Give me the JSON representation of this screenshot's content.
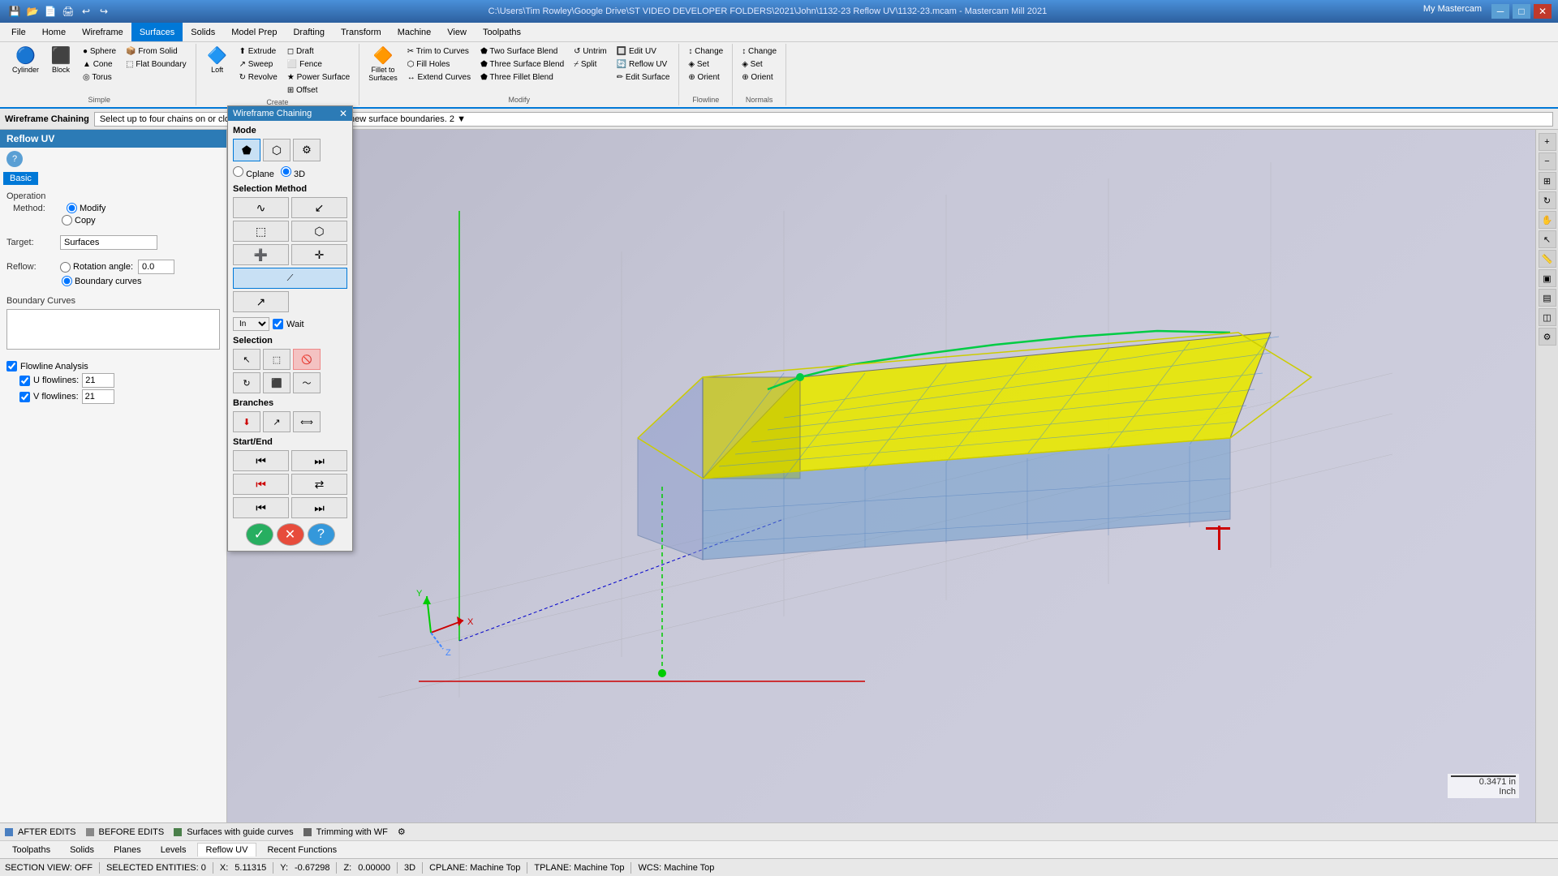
{
  "titlebar": {
    "title": "C:\\Users\\Tim Rowley\\Google Drive\\ST VIDEO DEVELOPER FOLDERS\\2021\\John\\1132-23 Reflow UV\\1132-23.mcam - Mastercam Mill 2021",
    "close": "✕",
    "maximize": "□",
    "minimize": "─",
    "my_mastercam": "My Mastercam"
  },
  "menubar": {
    "items": [
      "File",
      "Home",
      "Wireframe",
      "Surfaces",
      "Solids",
      "Model Prep",
      "Drafting",
      "Transform",
      "Machine",
      "View",
      "Toolpaths"
    ]
  },
  "ribbon": {
    "active_tab": "Surfaces",
    "groups": {
      "simple": {
        "title": "Simple",
        "items": [
          "Cylinder",
          "Block",
          "Sphere",
          "Cone",
          "Torus",
          "From Solid",
          "Flat Boundary"
        ]
      },
      "create": {
        "title": "Create",
        "items": [
          "Extrude",
          "Sweep",
          "Revolve",
          "Draft",
          "Fence",
          "Power Surface",
          "Offset",
          "Loft"
        ]
      },
      "modify": {
        "title": "Modify",
        "items": [
          "Trim to Curves",
          "Fill Holes",
          "Extend Curves",
          "Fillet to Surfaces",
          "Two Surface Blend",
          "Three Surface Blend",
          "Three Fillet Blend",
          "Untrim",
          "Split",
          "Edit UV",
          "Reflow UV",
          "Edit Surface"
        ]
      },
      "flowline": {
        "title": "Flowline",
        "items": [
          "Change",
          "Set",
          "Orient"
        ]
      },
      "normals": {
        "title": "Normals",
        "items": [
          "Change",
          "Set",
          "Orient"
        ]
      }
    }
  },
  "chaining": {
    "label": "Wireframe Chaining",
    "message": "Select up to four chains on or close to the surface to define the new surface boundaries.  2 ▼"
  },
  "left_panel": {
    "title": "Reflow UV",
    "tab": "Basic",
    "operation_label": "Operation",
    "method_label": "Method:",
    "method_options": [
      "Modify",
      "Copy"
    ],
    "method_selected": "Modify",
    "target_label": "Target:",
    "target_value": "Surfaces",
    "reflow_label": "Reflow:",
    "reflow_options": [
      "Rotation angle:",
      "Boundary curves"
    ],
    "reflow_selected": "Boundary curves",
    "rotation_angle": "0.0",
    "boundary_curves_label": "Boundary Curves",
    "flowline_label": "Flowline Analysis",
    "u_flowlines_checked": true,
    "u_flowlines_label": "U flowlines:",
    "u_flowlines_value": "21",
    "v_flowlines_checked": true,
    "v_flowlines_label": "V flowlines:",
    "v_flowlines_value": "21"
  },
  "wireframe_dialog": {
    "title": "Wireframe Chaining",
    "mode_label": "Mode",
    "mode_buttons": [
      "⬟",
      "⬡",
      "⚙"
    ],
    "plane_label1": "Cplane",
    "plane_label2": "3D",
    "selection_method_label": "Selection Method",
    "in_label": "In",
    "wait_label": "Wait",
    "selection_label": "Selection",
    "branches_label": "Branches",
    "startend_label": "Start/End",
    "ok_label": "✓",
    "cancel_label": "✕",
    "help_label": "?"
  },
  "status_bar": {
    "section_view": "SECTION VIEW: OFF",
    "selected_entities": "SELECTED ENTITIES: 0",
    "x_label": "X:",
    "x_value": "5.11315",
    "y_label": "Y:",
    "y_value": "-0.67298",
    "z_label": "Z:",
    "z_value": "0.00000",
    "mode": "3D",
    "cplane": "CPLANE: Machine Top",
    "tplane": "TPLANE: Machine Top",
    "wcs": "WCS: Machine Top"
  },
  "bottom_tabs": {
    "items": [
      "Toolpaths",
      "Solids",
      "Planes",
      "Levels",
      "Reflow UV",
      "Recent Functions"
    ],
    "active": "Reflow UV"
  },
  "legend": {
    "items": [
      "AFTER EDITS",
      "BEFORE EDITS",
      "Surfaces with guide curves",
      "Trimming with WF"
    ],
    "colors": [
      "#4a7fc1",
      "#888",
      "#4a7f4a",
      "#666"
    ]
  },
  "scale": "0.3471 in\nInch"
}
